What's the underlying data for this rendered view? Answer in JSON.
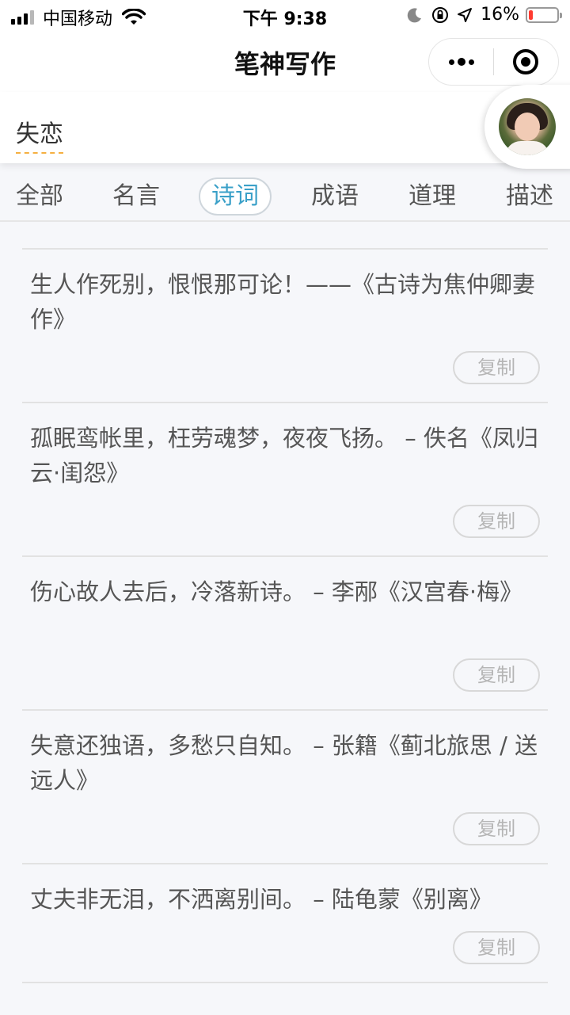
{
  "status_bar": {
    "carrier": "中国移动",
    "time": "下午 9:38",
    "battery": "16%",
    "battery_level": 0.16
  },
  "nav": {
    "title": "笔神写作"
  },
  "search": {
    "keyword": "失恋"
  },
  "tabs": [
    {
      "label": "全部"
    },
    {
      "label": "名言"
    },
    {
      "label": "诗词"
    },
    {
      "label": "成语"
    },
    {
      "label": "道理"
    },
    {
      "label": "描述"
    }
  ],
  "active_tab": "诗词",
  "items": [
    {
      "text": "生人作死别，恨恨那可论！——《古诗为焦仲卿妻作》",
      "copy_label": "复制"
    },
    {
      "text": "孤眠鸾帐里，枉劳魂梦，夜夜飞扬。 – 佚名《凤归云·闺怨》",
      "copy_label": "复制"
    },
    {
      "text": "伤心故人去后，冷落新诗。 – 李邴《汉宫春·梅》",
      "copy_label": "复制"
    },
    {
      "text": "失意还独语，多愁只自知。 – 张籍《蓟北旅思 / 送远人》",
      "copy_label": "复制"
    },
    {
      "text": "丈夫非无泪，不洒离别间。 – 陆龟蒙《别离》",
      "copy_label": "复制"
    }
  ],
  "colors": {
    "accent": "#3aa0c8",
    "underline": "#f5b041",
    "battery_low": "#ff3b30"
  }
}
